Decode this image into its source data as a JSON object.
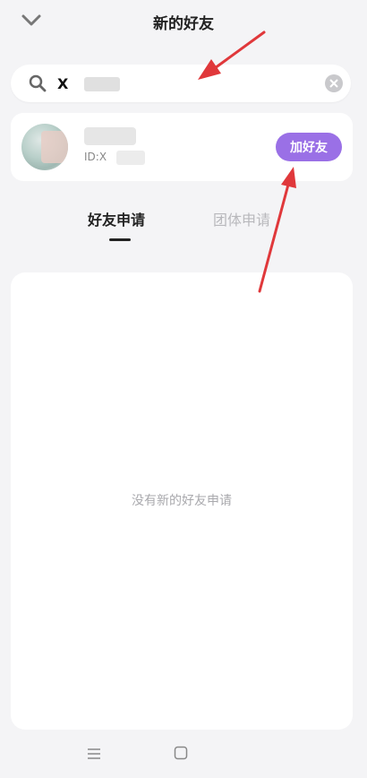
{
  "header": {
    "title": "新的好友"
  },
  "search": {
    "value": "X",
    "placeholder": ""
  },
  "result": {
    "id_label": "ID:X",
    "add_label": "加好友"
  },
  "tabs": [
    {
      "label": "好友申请"
    },
    {
      "label": "团体申请"
    }
  ],
  "empty_text": "没有新的好友申请",
  "colors": {
    "accent": "#9a70e6",
    "arrow": "#e0383b"
  },
  "icons": [
    "chevron-down-icon",
    "search-icon",
    "clear-icon",
    "menu-icon",
    "home-icon"
  ]
}
